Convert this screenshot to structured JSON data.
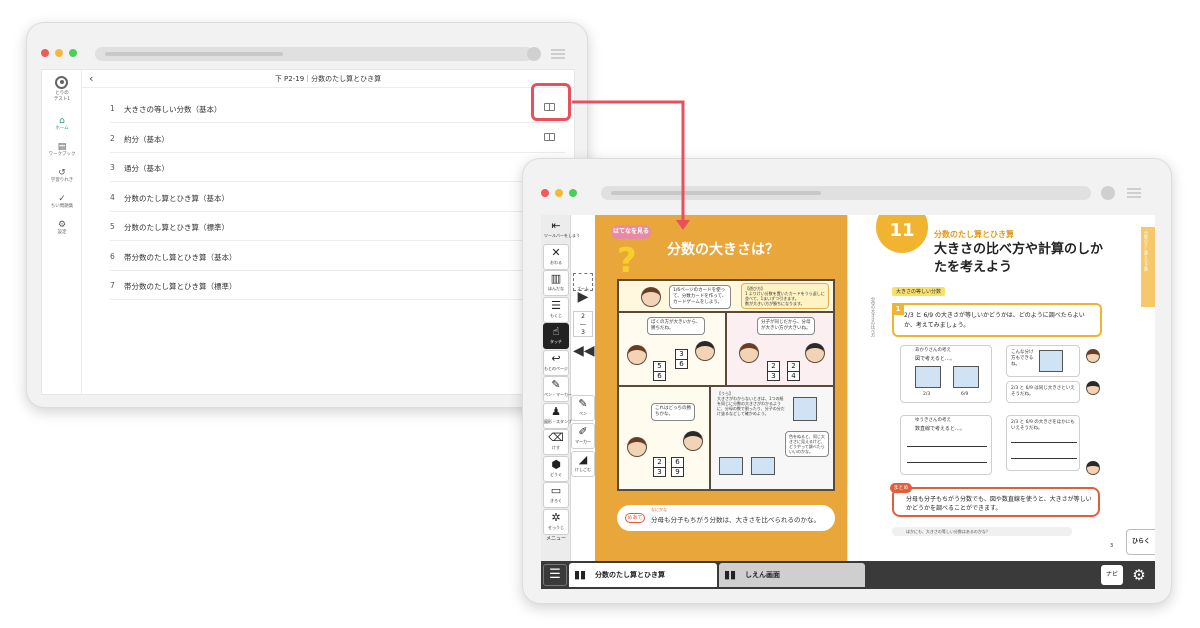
{
  "colors": {
    "highlight": "#e8505b",
    "active_nav": "#2f9a6b",
    "dot_red": "#f05a5a",
    "dot_yellow": "#f5b83a",
    "dot_green": "#4ccf5a",
    "page_orange": "#e8a63b"
  },
  "window1": {
    "user": {
      "name": "とりの\nテスト1"
    },
    "nav": [
      {
        "icon": "home-icon",
        "glyph": "⌂",
        "label": "ホーム",
        "active": true
      },
      {
        "icon": "workbook-icon",
        "glyph": "▤",
        "label": "ワークブック",
        "active": false
      },
      {
        "icon": "history-icon",
        "glyph": "↺",
        "label": "学習りれき",
        "active": false
      },
      {
        "icon": "check-icon",
        "glyph": "✓",
        "label": "ちい問題集",
        "active": false
      },
      {
        "icon": "settings-icon",
        "glyph": "⚙",
        "label": "設定",
        "active": false
      }
    ],
    "title": "下 P2-19｜分数のたし算とひき算",
    "lessons": [
      {
        "num": "1",
        "name": "大きさの等しい分数（基本）"
      },
      {
        "num": "2",
        "name": "約分（基本）"
      },
      {
        "num": "3",
        "name": "通分（基本）"
      },
      {
        "num": "4",
        "name": "分数のたし算とひき算（基本）"
      },
      {
        "num": "5",
        "name": "分数のたし算とひき算（標準）"
      },
      {
        "num": "6",
        "name": "帯分数のたし算とひき算（基本）"
      },
      {
        "num": "7",
        "name": "帯分数のたし算とひき算（標準）"
      }
    ]
  },
  "window2": {
    "tools": [
      {
        "icon": "toolbar-hide-icon",
        "glyph": "⇤",
        "label": "ツールバーをしまう",
        "style": "plain"
      },
      {
        "icon": "close-icon",
        "glyph": "✕",
        "label": "おわる",
        "style": "normal"
      },
      {
        "icon": "bookshelf-icon",
        "glyph": "▥",
        "label": "ほんだな",
        "style": "normal"
      },
      {
        "icon": "toc-icon",
        "glyph": "☰",
        "label": "もくじ",
        "style": "normal"
      },
      {
        "icon": "touch-icon",
        "glyph": "☝",
        "label": "タッチ",
        "style": "dark"
      },
      {
        "icon": "return-page-icon",
        "glyph": "↩",
        "label": "もとのページ",
        "style": "normal"
      },
      {
        "icon": "pen-marker-icon",
        "glyph": "✎",
        "label": "ペン・マーカー",
        "style": "normal"
      },
      {
        "icon": "stamp-icon",
        "glyph": "♟",
        "label": "図形・スタンプ",
        "style": "normal"
      },
      {
        "icon": "erase-icon",
        "glyph": "⌫",
        "label": "けす",
        "style": "normal"
      },
      {
        "icon": "tools-icon",
        "glyph": "⬢",
        "label": "どうぐ",
        "style": "normal"
      },
      {
        "icon": "kiroku-icon",
        "glyph": "▭",
        "label": "きろく",
        "style": "normal"
      },
      {
        "icon": "settings-small-icon",
        "glyph": "✲",
        "label": "せっうじ",
        "style": "normal"
      }
    ],
    "menu_label": "メニュー",
    "zoom_label": "ズーム",
    "page_nav": {
      "top": "2",
      "bottom": "3"
    },
    "tools2": [
      {
        "icon": "pen-icon",
        "glyph": "✎",
        "label": "ペン"
      },
      {
        "icon": "marker-icon",
        "glyph": "✐",
        "label": "マーカー"
      },
      {
        "icon": "eraser-icon",
        "glyph": "◢",
        "label": "けしごむ"
      }
    ],
    "left_page": {
      "badge": "はてなを見る",
      "title": "分数の大きさは？",
      "panel1_bubble": "1/6ページのカードを使って、分数カードを作って、カードゲームをしよう。",
      "panel1_rule": "【遊び方】\n1 よりけい分数を置いたカードをうら返しに並べて、1まいずつ引きます。\n数が大きい方が勝ちになります。",
      "panel2_bubble": "ぼくの方が大きいから、勝ちだね。",
      "panel3_bubble": "分子が同じだから、分母が大きい方が大きいね。",
      "panel4_bubble": "これはどっちの勝ちかな。",
      "panel5_text": "【うら】\n大きさがわからないときは、1つの紙を同じに分数の大きさがわかるように、分母の数で割ったり、分子の分だけ塗るなどして確かめよう。",
      "panel5_bubble": "色をぬると、同じ大きさに見えるけど、どうやって調べたらいいのかな。",
      "card_fracs": [
        "5/6",
        "3/6",
        "2/3",
        "2/4",
        "2/3",
        "6/9"
      ],
      "summary_tag": "めあて",
      "summary_small": "なにかな",
      "summary": "分母も分子もちがう分数は、大きさを比べられるのかな。"
    },
    "right_page": {
      "unit_no": "11",
      "unit_sub": "分数のたし算とひき算",
      "unit_title": "大きさの比べ方や計算のしかたを考えよう",
      "side_tab": "分数のたし算とひき算",
      "vertical_note": "分母の大きさの比べ方",
      "subhead": "大きさの等しい分数",
      "q_num": "1",
      "question": "2/3 と 6/9 の大きさが等しいかどうかは、どのように調べたらよいか、考えてみましょう。",
      "work1_title": "あかりさんの考え",
      "work1_text": "図で考えると…。",
      "work1_fracs": [
        "2/3",
        "6/9"
      ],
      "work2_text": "こんな分け方もできるね。",
      "work3_text": "2/3 と 6/9 は同じ大きさといえそうだね。",
      "work4_title": "ゆうきさんの考え",
      "work4_text": "数直線で考えると…。",
      "work5_text": "2/3 と 6/9 の大きさをほかにもいえそうだね。",
      "matome_tag": "まとめ",
      "matome": "分母も分子もちがう分数でも、図や数直線を使うと、大きさが等しいかどうかを調べることができます。",
      "hint": "ほかにも、大きさの等しい分数はあるのかな？",
      "open_btn": "ひらく",
      "page_no": "3"
    },
    "bottom": {
      "tab1": "分数のたし算とひき算",
      "tab2": "しえん画面",
      "navi": "ナビ"
    }
  }
}
